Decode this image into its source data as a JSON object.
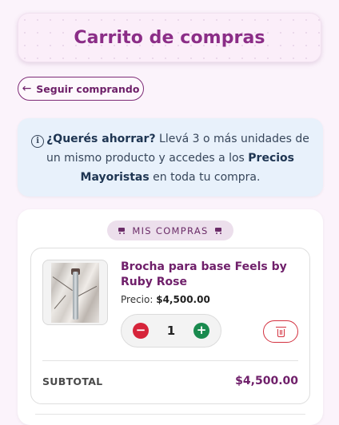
{
  "header": {
    "title": "Carrito de compras"
  },
  "nav": {
    "back_label": "Seguir comprando"
  },
  "info_banner": {
    "icon": "info-icon",
    "highlight": "¿Querés ahorrar?",
    "text_before": " Llevá 3 o más unidades de un mismo producto y accedes a los ",
    "link_text": "Precios Mayoristas",
    "text_after": " en toda tu compra."
  },
  "cart": {
    "section_label": "MIS COMPRAS",
    "items": [
      {
        "name": "Brocha para base Feels by Ruby Rose",
        "price_label": "Precio:",
        "price": "$4,500.00",
        "quantity": "1",
        "minus_symbol": "−",
        "plus_symbol": "+",
        "subtotal_label": "SUBTOTAL",
        "subtotal": "$4,500.00"
      }
    ]
  },
  "colors": {
    "brand": "#8b2d87",
    "minus": "#d6243a",
    "plus": "#198a4e",
    "delete": "#d3313f",
    "info_bg": "#e8f1fb"
  }
}
